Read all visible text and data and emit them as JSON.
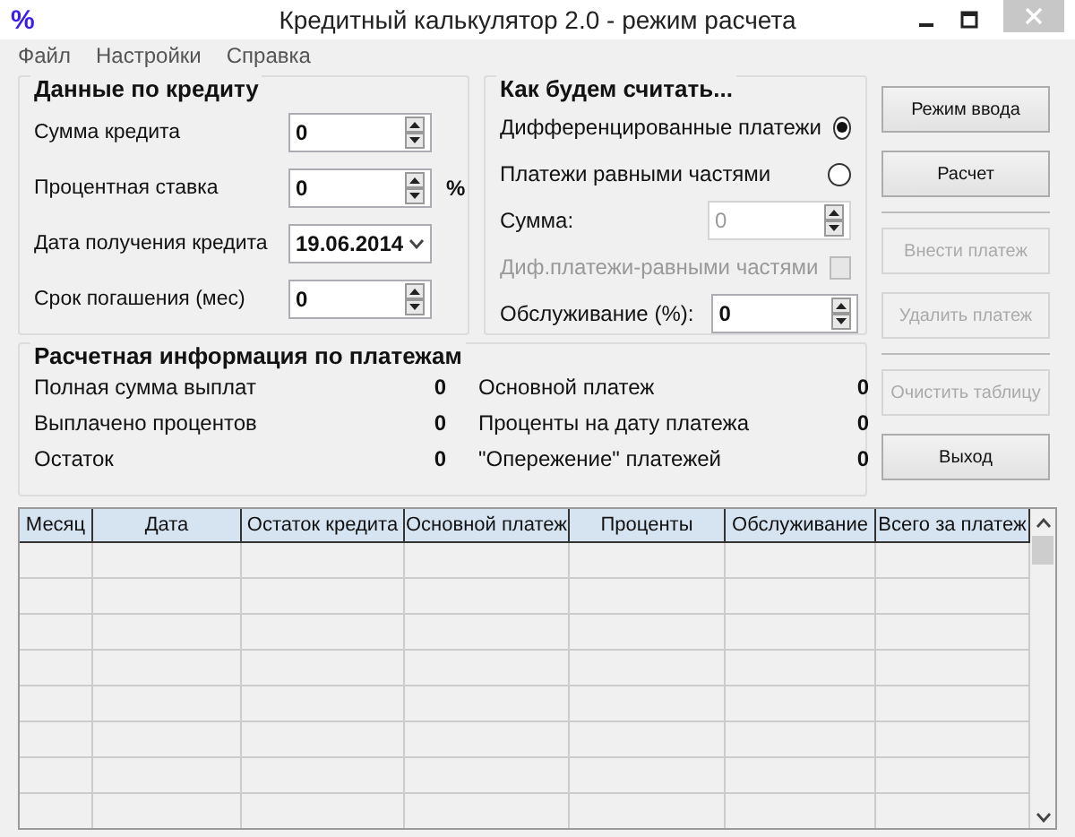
{
  "window": {
    "icon": "%",
    "title": "Кредитный калькулятор 2.0 - режим расчета"
  },
  "menu": [
    "Файл",
    "Настройки",
    "Справка"
  ],
  "loan_data": {
    "title": "Данные по кредиту",
    "fields": [
      {
        "kind": "spin",
        "label": "Сумма кредита",
        "value": "0"
      },
      {
        "kind": "spin",
        "label": "Процентная ставка",
        "value": "0",
        "suffix": "%"
      },
      {
        "kind": "date",
        "label": "Дата получения кредита",
        "value": "19.06.2014"
      },
      {
        "kind": "spin",
        "label": "Срок погашения (мес)",
        "value": "0"
      }
    ]
  },
  "method": {
    "title": "Как будем считать...",
    "options": [
      {
        "label": "Дифференцированные платежи",
        "selected": true
      },
      {
        "label": "Платежи равными частями",
        "selected": false
      }
    ],
    "sum": {
      "label": "Сумма:",
      "value": "0",
      "disabled": true
    },
    "combine": {
      "label": "Диф.платежи-равными частями",
      "checked": false,
      "disabled": true
    },
    "service": {
      "label": "Обслуживание (%):",
      "value": "0"
    }
  },
  "summary": {
    "title": "Расчетная информация по платежам",
    "items": [
      {
        "label": "Полная сумма выплат",
        "value": "0"
      },
      {
        "label": "Основной платеж",
        "value": "0"
      },
      {
        "label": "Выплачено процентов",
        "value": "0"
      },
      {
        "label": "Проценты на дату платежа",
        "value": "0"
      },
      {
        "label": "Остаток",
        "value": "0"
      },
      {
        "label": "\"Опережение\" платежей",
        "value": "0"
      }
    ]
  },
  "button_groups": [
    [
      {
        "label": "Режим ввода",
        "disabled": false
      },
      {
        "label": "Расчет",
        "disabled": false
      }
    ],
    [
      {
        "label": "Внести платеж",
        "disabled": true
      },
      {
        "label": "Удалить платеж",
        "disabled": true
      }
    ],
    [
      {
        "label": "Очистить таблицу",
        "disabled": true
      },
      {
        "label": "Выход",
        "disabled": false
      }
    ]
  ],
  "table": {
    "columns": [
      "Месяц",
      "Дата",
      "Остаток кредита",
      "Основной платеж",
      "Проценты",
      "Обслуживание",
      "Всего за платеж"
    ]
  }
}
